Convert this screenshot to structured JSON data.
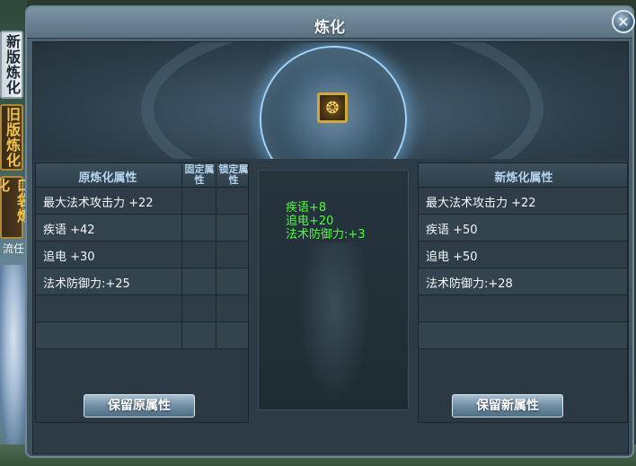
{
  "side_tabs": [
    {
      "label": "新版炼化",
      "active": true
    },
    {
      "label": "旧版炼化",
      "active": false
    },
    {
      "label": "口袋炼化",
      "active": false
    }
  ],
  "side_text": "流任",
  "window": {
    "title": "炼化",
    "close_label": "✕"
  },
  "original": {
    "header": "原炼化属性",
    "col_fixed": "固定属性",
    "col_locked": "锁定属性",
    "rows": [
      "最大法术攻击力 +22",
      "疾语 +42",
      "追电 +30",
      "法术防御力:+25",
      "",
      ""
    ],
    "button": "保留原属性"
  },
  "changes": [
    "疾语+8",
    "追电+20",
    "法术防御力:+3"
  ],
  "refined": {
    "header": "新炼化属性",
    "rows": [
      "最大法术攻击力 +22",
      "疾语 +50",
      "追电 +50",
      "法术防御力:+28",
      "",
      ""
    ],
    "button": "保留新属性"
  },
  "colors": {
    "delta_green": "#4cff3a",
    "header_blue": "#b5d4ee",
    "orb_glow": "#9fd4ff",
    "tab_gold": "#f0c24a"
  },
  "icons": {
    "item_slot": "refining-item-icon",
    "close": "close-icon"
  }
}
